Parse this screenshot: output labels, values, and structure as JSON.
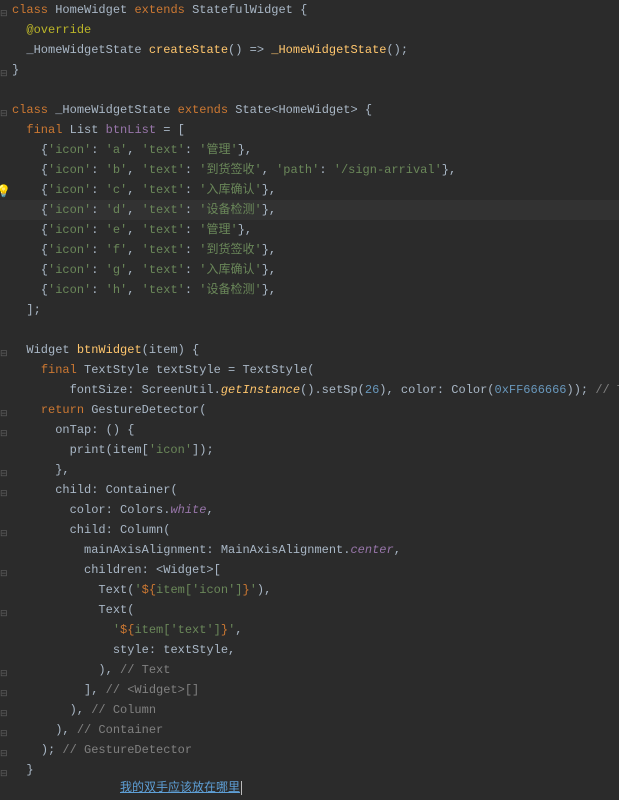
{
  "code": {
    "l1_class": "class",
    "l1_name": "HomeWidget",
    "l1_extends": "extends",
    "l1_super": "StatefulWidget",
    "l2_override": "@override",
    "l3_type": "_HomeWidgetState",
    "l3_fn": "createState",
    "l3_arrow": "() =>",
    "l3_call": "_HomeWidgetState",
    "l3_tail": "();",
    "l4_brace": "}",
    "l6_class": "class",
    "l6_name": "_HomeWidgetState",
    "l6_extends": "extends",
    "l6_state": "State",
    "l6_generic": "HomeWidget",
    "l7_final": "final",
    "l7_list": "List",
    "l7_var": "btnList",
    "l7_eq": " = [",
    "items": [
      {
        "icon": "a",
        "text": "管理"
      },
      {
        "icon": "b",
        "text": "到货签收",
        "path": "/sign-arrival"
      },
      {
        "icon": "c",
        "text": "入库确认"
      },
      {
        "icon": "d",
        "text": "设备检测"
      },
      {
        "icon": "e",
        "text": "管理"
      },
      {
        "icon": "f",
        "text": "到货签收"
      },
      {
        "icon": "g",
        "text": "入库确认"
      },
      {
        "icon": "h",
        "text": "设备检测"
      }
    ],
    "l16_close": "];",
    "l18_widget": "Widget",
    "l18_fn": "btnWidget",
    "l18_param": "(item) {",
    "l19_final": "final",
    "l19_ts": "TextStyle",
    "l19_var": "textStyle",
    "l19_eq": " = ",
    "l19_tsc": "TextStyle",
    "l20_font": "fontSize: ScreenUtil.",
    "l20_gi": "getInstance",
    "l20_sp": "().setSp(",
    "l20_num": "26",
    "l20_col": "), color: Color(",
    "l20_hex": "0xFF666666",
    "l20_end": ")); ",
    "l20_cm": "// TextStyle",
    "l21_return": "return",
    "l21_gd": "GestureDetector",
    "l22_ontap": "onTap: () {",
    "l23_print": "print(item[",
    "l23_icon": "'icon'",
    "l23_end": "]);",
    "l24_brace": "},",
    "l25_child1": "child: ",
    "l25_cont": "Container",
    "l26_color": "color: Colors.",
    "l26_white": "white",
    "l27_child2": "child: ",
    "l27_col": "Column",
    "l28_maa": "mainAxisAlignment: MainAxisAlignment.",
    "l28_center": "center",
    "l29_children": "children: <Widget>[",
    "l30_text": "Text",
    "l30_pre": "('",
    "l30_interp": "${item[",
    "l30_icon2": "'icon'",
    "l30_post": "]}",
    "l30_end": "'),",
    "l31_text": "Text",
    "l32_pre": "'",
    "l32_interp": "${item[",
    "l32_text2": "'text'",
    "l32_post": "]}",
    "l32_end": "',",
    "l33_style": "style: textStyle,",
    "l34_close": "), ",
    "l34_cm": "// Text",
    "l35_close": "], ",
    "l35_cm": "// <Widget>[]",
    "l36_close": "), ",
    "l36_cm": "// Column",
    "l37_close": "), ",
    "l37_cm": "// Container",
    "l38_close": "); ",
    "l38_cm": "// GestureDetector",
    "l39_brace": "}"
  },
  "ime_text": "我的双手应该放在哪里"
}
